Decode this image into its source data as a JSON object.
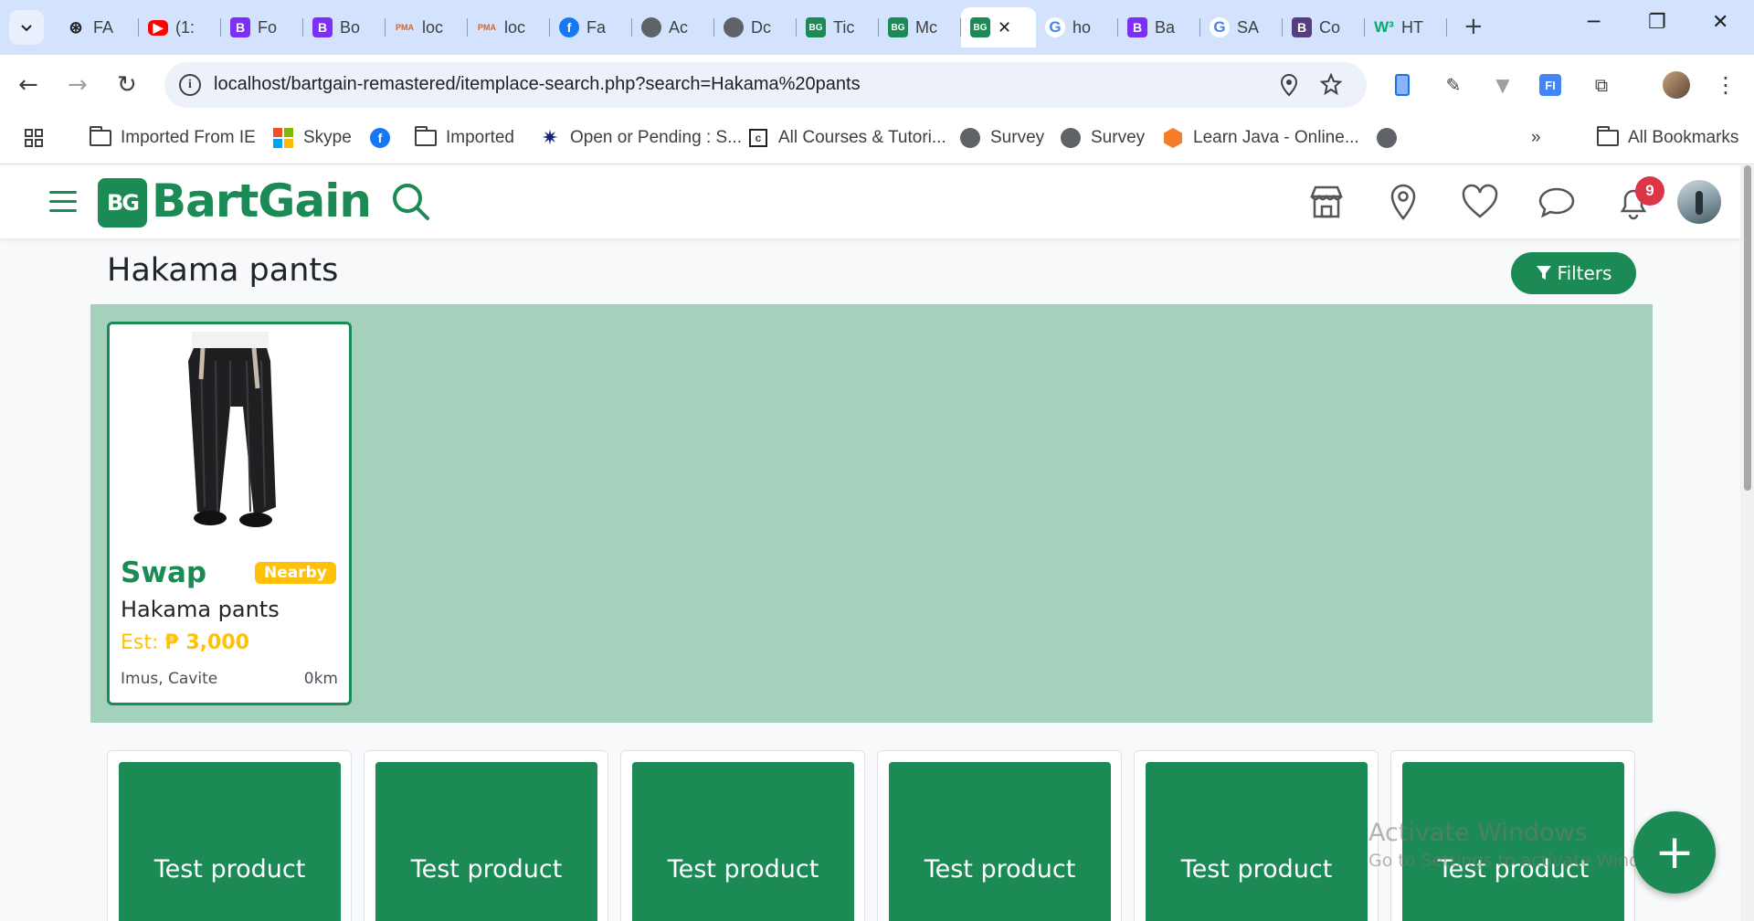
{
  "browser": {
    "tabs": [
      {
        "title": "FA",
        "icon": "chatgpt-icon",
        "glyph": "⊛",
        "cls": "chatgpt"
      },
      {
        "title": "(1:",
        "icon": "youtube-icon",
        "glyph": "▶",
        "cls": "yt"
      },
      {
        "title": "Fo",
        "icon": "bootstrap-icon",
        "glyph": "B",
        "cls": "bs"
      },
      {
        "title": "Bo",
        "icon": "bootstrap-icon",
        "glyph": "B",
        "cls": "bs"
      },
      {
        "title": "loc",
        "icon": "phpmyadmin-icon",
        "glyph": "PMA",
        "cls": "pma"
      },
      {
        "title": "loc",
        "icon": "phpmyadmin-icon",
        "glyph": "PMA",
        "cls": "pma"
      },
      {
        "title": "Fa",
        "icon": "facebook-icon",
        "glyph": "f",
        "cls": "fb"
      },
      {
        "title": "Ac",
        "icon": "globe-icon",
        "glyph": "",
        "cls": "globe"
      },
      {
        "title": "Dc",
        "icon": "globe-icon",
        "glyph": "",
        "cls": "globe"
      },
      {
        "title": "Tic",
        "icon": "bartgain-icon",
        "glyph": "BG",
        "cls": "bg"
      },
      {
        "title": "Mc",
        "icon": "bartgain-icon",
        "glyph": "BG",
        "cls": "bg"
      },
      {
        "title": "",
        "icon": "bartgain-icon",
        "glyph": "BG",
        "cls": "bg",
        "active": true
      },
      {
        "title": "ho",
        "icon": "google-icon",
        "glyph": "G",
        "cls": "g"
      },
      {
        "title": "Ba",
        "icon": "bootstrap-icon",
        "glyph": "B",
        "cls": "bs"
      },
      {
        "title": "SA",
        "icon": "google-icon",
        "glyph": "G",
        "cls": "g"
      },
      {
        "title": "Co",
        "icon": "bootstrap-icon",
        "glyph": "B",
        "cls": "bsdark"
      },
      {
        "title": "HT",
        "icon": "w3schools-icon",
        "glyph": "W³",
        "cls": "w3"
      }
    ],
    "url": "localhost/bartgain-remastered/itemplace-search.php?search=Hakama%20pants",
    "bookmarks": [
      {
        "label": "Imported From IE",
        "icon": "folder-icon"
      },
      {
        "label": "Skype",
        "icon": "microsoft-icon"
      },
      {
        "label": "",
        "icon": "facebook-icon"
      },
      {
        "label": "Imported",
        "icon": "folder-icon"
      },
      {
        "label": "Open or Pending : S...",
        "icon": "star-burst-icon"
      },
      {
        "label": "All Courses & Tutori...",
        "icon": "course-icon"
      },
      {
        "label": "Survey",
        "icon": "globe-icon"
      },
      {
        "label": "Survey",
        "icon": "globe-icon"
      },
      {
        "label": "Learn Java - Online...",
        "icon": "learn-java-icon"
      },
      {
        "label": "",
        "icon": "globe-icon"
      }
    ],
    "all_bookmarks_label": "All Bookmarks"
  },
  "site": {
    "logo_mark": "BG",
    "logo_text": "BartGain",
    "notification_count": "9"
  },
  "search": {
    "title": "Hakama pants",
    "filters_label": "Filters"
  },
  "result": {
    "type": "Swap",
    "badge": "Nearby",
    "name": "Hakama pants",
    "price_prefix": "Est:",
    "price": "₱ 3,000",
    "location": "Imus, Cavite",
    "distance": "0km"
  },
  "more_items": [
    {
      "label": "Test product"
    },
    {
      "label": "Test product"
    },
    {
      "label": "Test product"
    },
    {
      "label": "Test product"
    },
    {
      "label": "Test product"
    },
    {
      "label": "Test product"
    }
  ],
  "watermark": {
    "line1": "Activate Windows",
    "line2": "Go to Settings to activate Windows."
  },
  "colors": {
    "brand_green": "#1b8a55",
    "panel_green": "#a5d0bb",
    "badge_yellow": "#ffc107",
    "notif_red": "#dc3545"
  }
}
